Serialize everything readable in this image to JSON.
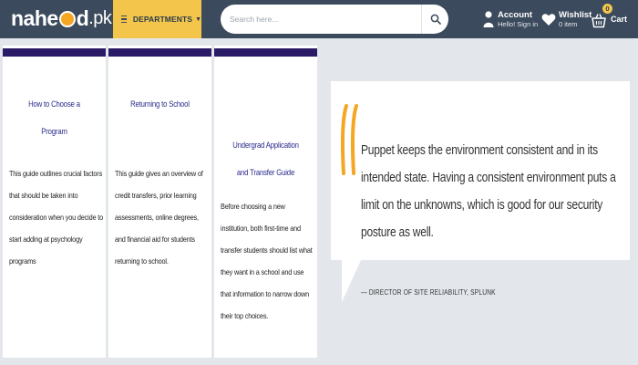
{
  "header": {
    "logo_text": "nahe",
    "logo_text_end": "d",
    "logo_tld": ".pk",
    "departments_label": "DEPARTMENTS",
    "search_placeholder": "Search here...",
    "account_title": "Account",
    "account_subtitle": "Hello! Sign in",
    "wishlist_title": "Wishlist",
    "wishlist_subtitle": "0 item",
    "cart_label": "Cart",
    "cart_count": "0",
    "colors": {
      "header_bg": "#3b4a5c",
      "accent": "#f3c64b"
    }
  },
  "guides": [
    {
      "title": "How to Choose a Program",
      "description": "This guide outlines crucial factors that should be taken into consideration when you decide to start adding at psychology programs"
    },
    {
      "title": "Returning to School",
      "description": "This guide gives an overview of credit transfers, prior learning assessments, online degrees, and financial aid for students returning to school."
    },
    {
      "title": "Undergrad Application and Transfer Guide",
      "description": "Before choosing a new institution, both first-time and transfer students should list what they want in a school and use that information to narrow down their top choices."
    }
  ],
  "quote": {
    "text": "Puppet keeps the environment consistent and in its intended state. Having a consistent environment puts a limit on the unknowns, which is good for our security posture as well.",
    "attribution": "— DIRECTOR OF SITE RELIABILITY, SPLUNK",
    "quote_mark_color": "#f5a623"
  }
}
